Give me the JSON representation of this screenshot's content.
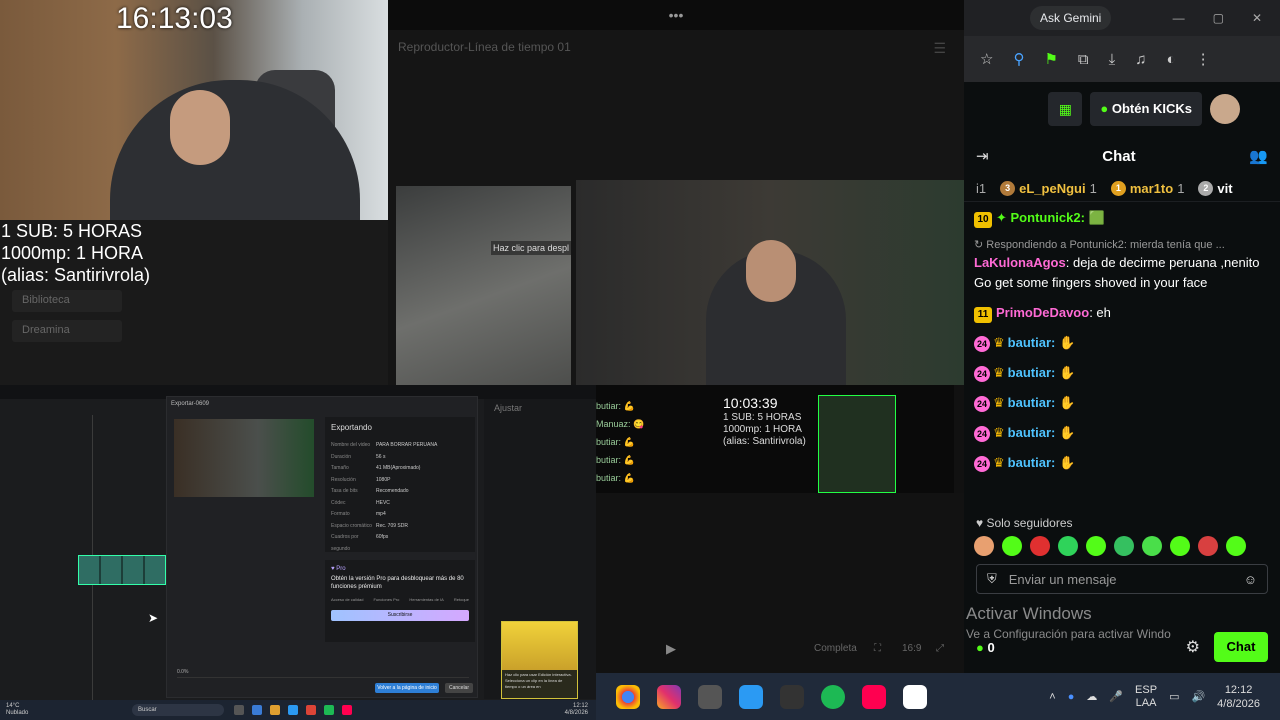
{
  "stream_overlay": {
    "clock": "16:13:03",
    "sub_line": "1 SUB: 5 HORAS",
    "mp_line": "1000mp: 1 HORA",
    "alias_line": "(alias: Santirivrola)"
  },
  "ghost_sidebar": [
    "Biblioteca",
    "Dreamina"
  ],
  "player": {
    "handle": "•••",
    "title": "Reproductor-Línea de tiempo 01",
    "hint": "Haz clic para despl",
    "inner_clock": "10:03:39",
    "inner_sub": "1 SUB: 5 HORAS",
    "inner_mp": "1000mp: 1 HORA",
    "inner_alias": "(alias: Santirivrola)",
    "inner_chat": [
      "butiar: 💪",
      "Manuaz: 😋",
      "butiar: 💪",
      "butiar: 💪",
      "butiar: 💪"
    ],
    "controls": {
      "play": "▶",
      "mode": "Completa",
      "ratio": "16:9"
    }
  },
  "export_dialog": {
    "header": "Exportar-0609",
    "title": "Exportando",
    "props": [
      {
        "k": "Nombre del video",
        "v": "PARA BORRAR PERUANA"
      },
      {
        "k": "Duración",
        "v": "56 s"
      },
      {
        "k": "Tamaño",
        "v": "41 MB(Aproximado)"
      },
      {
        "k": "Resolución",
        "v": "1080P"
      },
      {
        "k": "Tasa de bits",
        "v": "Recomendado"
      },
      {
        "k": "Códec",
        "v": "HEVC"
      },
      {
        "k": "Formato",
        "v": "mp4"
      },
      {
        "k": "Espacio cromático",
        "v": "Rec. 709 SDR"
      },
      {
        "k": "Cuadros por segundo",
        "v": "60fps"
      }
    ],
    "pro_badge": "♥ Pro",
    "pro_text": "Obtén la versión Pro para desbloquear más de 80 funciones prémium",
    "pro_features": [
      "Acceso de calidad",
      "Funciones Pro",
      "Herramientas de IA",
      "Retoque"
    ],
    "subscribe": "Suscribirse",
    "progress": "0.0%",
    "go_button": "Volver a la página de inicio",
    "cancel_button": "Cancelar"
  },
  "editor": {
    "right_label": "Ajustar",
    "tooltip_text": "Haz clic para usar Edición interactiva. Selecciona un clip en la línea de tiempo o un área en"
  },
  "small_taskbar": {
    "weather_temp": "14°C",
    "weather_desc": "Nublado",
    "search": "Buscar",
    "time": "12:12",
    "date": "4/8/2026"
  },
  "browser": {
    "ask_gemini": "Ask Gemini",
    "win_controls": [
      "—",
      "▢",
      "✕"
    ]
  },
  "kick": {
    "kicks_label": "Obtén KICKs",
    "chat_title": "Chat",
    "gifters": [
      {
        "rank": "i1",
        "name": "",
        "count": ""
      },
      {
        "rank": "3",
        "name": "eL_peNgui",
        "count": "1"
      },
      {
        "rank": "1",
        "name": "mar1to",
        "count": "1"
      },
      {
        "rank": "2",
        "name": "vit",
        "count": ""
      }
    ],
    "messages": [
      {
        "lvl": "10",
        "user": "Pontunick2:",
        "color": "#53fc18",
        "text": "",
        "emote": "🟩"
      },
      {
        "reply": "↻ Respondiendo a Pontunick2: mierda tenía que ...",
        "user": "LaKulonaAgos",
        "color": "#ff6ad5",
        "text": ": deja de decirme peruana ,nenito Go get some fingers shoved in your face"
      },
      {
        "lvl": "11",
        "user": "PrimoDeDavoo",
        "color": "#ff6ad5",
        "text": ": eh"
      },
      {
        "pink": "24",
        "user": "bautiar:",
        "color": "#ff6ad5",
        "emote": "✋"
      },
      {
        "pink": "24",
        "user": "bautiar:",
        "color": "#ff6ad5",
        "emote": "✋"
      },
      {
        "pink": "24",
        "user": "bautiar:",
        "color": "#ff6ad5",
        "emote": "✋"
      },
      {
        "pink": "24",
        "user": "bautiar:",
        "color": "#ff6ad5",
        "emote": "✋"
      },
      {
        "pink": "24",
        "user": "bautiar:",
        "color": "#ff6ad5",
        "emote": "✋"
      }
    ],
    "followers_only": "♥ Solo seguidores",
    "placeholder": "Enviar un mensaje",
    "kicks_count": "0",
    "send": "Chat",
    "activate_title": "Activar Windows",
    "activate_sub": "Ve a Configuración para activar Windo"
  },
  "taskbar": {
    "lang1": "ESP",
    "lang2": "LAA",
    "time": "12:12",
    "date": "4/8/2026"
  },
  "colors": {
    "kick_green": "#53fc18",
    "pink": "#ff6ad5",
    "gold": "#f2b705"
  }
}
